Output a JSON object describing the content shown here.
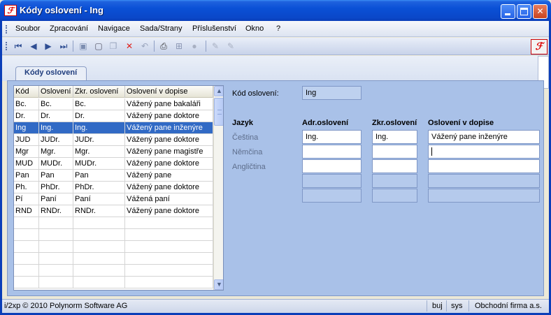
{
  "window": {
    "title": "Kódy oslovení - Ing",
    "logo_text": "ℱ",
    "controls": {
      "minimize": "",
      "maximize": "",
      "close": "✕"
    }
  },
  "menu": [
    "Soubor",
    "Zpracování",
    "Navigace",
    "Sada/Strany",
    "Příslušenství",
    "Okno",
    "?"
  ],
  "toolbar": {
    "icons": [
      "first-record-icon",
      "prev-record-icon",
      "next-record-icon",
      "last-record-icon",
      "save-icon",
      "new-icon",
      "copy-icon",
      "delete-icon",
      "undo-icon",
      "print-icon",
      "structure-icon",
      "info-icon",
      "edit-icon",
      "edit-alt-icon"
    ],
    "glyphs": {
      "first": "⏮",
      "prev": "◀",
      "next": "▶",
      "last": "⏭",
      "save": "▣",
      "new": "▢",
      "copy": "❐",
      "delete": "✕",
      "undo": "↶",
      "print": "⎙",
      "structure": "⊞",
      "info": "●",
      "edit": "✎",
      "edit2": "✎"
    }
  },
  "tab": {
    "label": "Kódy oslovení"
  },
  "grid": {
    "columns": [
      "Kód",
      "Oslovení",
      "Zkr. oslovení",
      "Oslovení v dopise"
    ],
    "rows": [
      [
        "Bc.",
        "Bc.",
        "Bc.",
        "Vážený pane bakaláři"
      ],
      [
        "Dr.",
        "Dr.",
        "Dr.",
        "Vážený pane doktore"
      ],
      [
        "Ing",
        "Ing.",
        "Ing.",
        "Vážený pane inženýre"
      ],
      [
        "JUD",
        "JUDr.",
        "JUDr.",
        "Vážený pane doktore"
      ],
      [
        "Mgr",
        "Mgr.",
        "Mgr.",
        "Vážený pane magistře"
      ],
      [
        "MUD",
        "MUDr.",
        "MUDr.",
        "Vážený pane doktore"
      ],
      [
        "Pan",
        "Pan",
        "Pan",
        "Vážený pane"
      ],
      [
        "Ph.",
        "PhDr.",
        "PhDr.",
        "Vážený pane doktore"
      ],
      [
        "Pí",
        "Paní",
        "Paní",
        "Vážená paní"
      ],
      [
        "RND",
        "RNDr.",
        "RNDr.",
        "Vážený pane doktore"
      ]
    ],
    "selected_index": 2,
    "empty_rows": 6
  },
  "form": {
    "code_label": "Kód oslovení:",
    "code_value": "Ing",
    "headers": {
      "language": "Jazyk",
      "adr": "Adr.oslovení",
      "zkr": "Zkr.oslovení",
      "letter": "Oslovení v dopise"
    },
    "languages": [
      {
        "name": "Čeština",
        "adr": "Ing.",
        "zkr": "Ing.",
        "letter": "Vážený pane inženýre"
      },
      {
        "name": "Němčina",
        "adr": "",
        "zkr": "",
        "letter": ""
      },
      {
        "name": "Angličtina",
        "adr": "",
        "zkr": "",
        "letter": ""
      }
    ]
  },
  "status": {
    "copyright": "i/2xp © 2010 Polynorm Software AG",
    "user": "buj",
    "db": "sys",
    "company": "Obchodní firma a.s."
  }
}
